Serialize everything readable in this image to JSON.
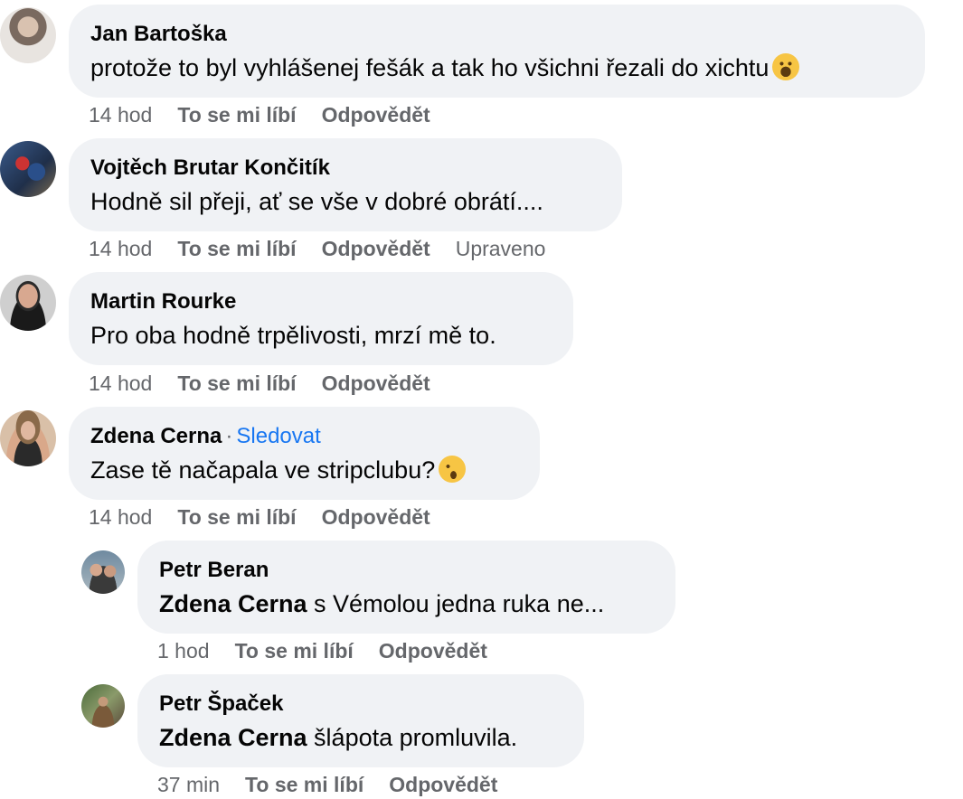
{
  "comments": [
    {
      "author": "Jan Bartoška",
      "text": "protože to byl vyhlášenej fešák a tak ho všichni řezali do xichtu",
      "emoji": "grinning-face-emoji",
      "time": "14 hod",
      "like": "To se mi líbí",
      "reply": "Odpovědět"
    },
    {
      "author": "Vojtěch Brutar Končitík",
      "text": "Hodně sil přeji, ať se vše v dobré obrátí....",
      "time": "14 hod",
      "like": "To se mi líbí",
      "reply": "Odpovědět",
      "edited": "Upraveno"
    },
    {
      "author": "Martin Rourke",
      "text": "Pro oba hodně trpělivosti, mrzí mě to.",
      "time": "14 hod",
      "like": "To se mi líbí",
      "reply": "Odpovědět"
    },
    {
      "author": "Zdena Cerna",
      "separator": "·",
      "follow": "Sledovat",
      "text": "Zase tě načapala ve stripclubu?",
      "emoji": "winking-face-emoji",
      "time": "14 hod",
      "like": "To se mi líbí",
      "reply": "Odpovědět"
    }
  ],
  "replies": [
    {
      "author": "Petr Beran",
      "mention": "Zdena Cerna",
      "text": " s Vémolou jedna ruka ne...",
      "time": "1 hod",
      "like": "To se mi líbí",
      "reply": "Odpovědět"
    },
    {
      "author": "Petr Špaček",
      "mention": "Zdena Cerna",
      "text": " šlápota promluvila.",
      "time": "37 min",
      "like": "To se mi líbí",
      "reply": "Odpovědět"
    }
  ],
  "colors": {
    "bubble": "#f0f2f5",
    "meta": "#65676b",
    "link": "#1877f2",
    "emoji": "#f7c544"
  }
}
